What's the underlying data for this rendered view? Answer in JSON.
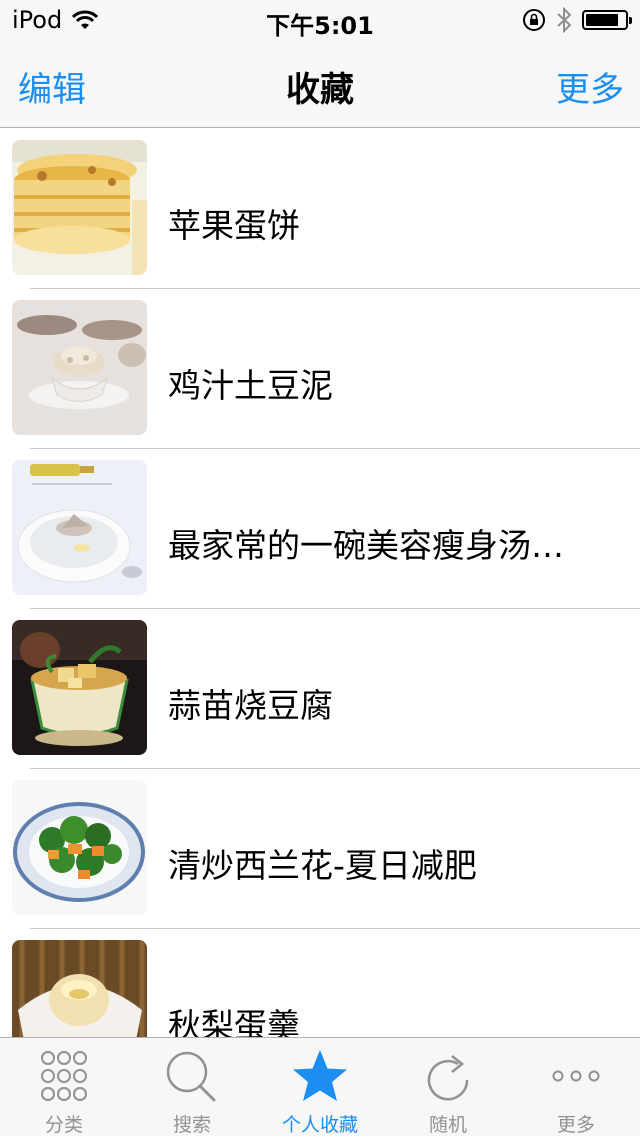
{
  "status_bar": {
    "carrier": "iPod",
    "time": "下午5:01",
    "battery_level": 0.85
  },
  "nav": {
    "left": "编辑",
    "title": "收藏",
    "right": "更多"
  },
  "list": {
    "items": [
      {
        "title": "苹果蛋饼",
        "image": "apple-egg-pancake"
      },
      {
        "title": "鸡汁土豆泥",
        "image": "mashed-potato"
      },
      {
        "title": "最家常的一碗美容瘦身汤…",
        "image": "soup-bowl"
      },
      {
        "title": "蒜苗烧豆腐",
        "image": "tofu-bowl"
      },
      {
        "title": "清炒西兰花-夏日减肥",
        "image": "broccoli-plate"
      },
      {
        "title": "秋梨蛋羹",
        "image": "pear-custard"
      }
    ]
  },
  "tabs": [
    {
      "label": "分类",
      "icon": "grid-icon",
      "active": false
    },
    {
      "label": "搜索",
      "icon": "search-icon",
      "active": false
    },
    {
      "label": "个人收藏",
      "icon": "star-icon",
      "active": true
    },
    {
      "label": "随机",
      "icon": "refresh-icon",
      "active": false
    },
    {
      "label": "更多",
      "icon": "more-icon",
      "active": false
    }
  ],
  "colors": {
    "accent": "#1b8ef0",
    "inactive": "#929292",
    "bar_background": "#f7f7f7"
  }
}
